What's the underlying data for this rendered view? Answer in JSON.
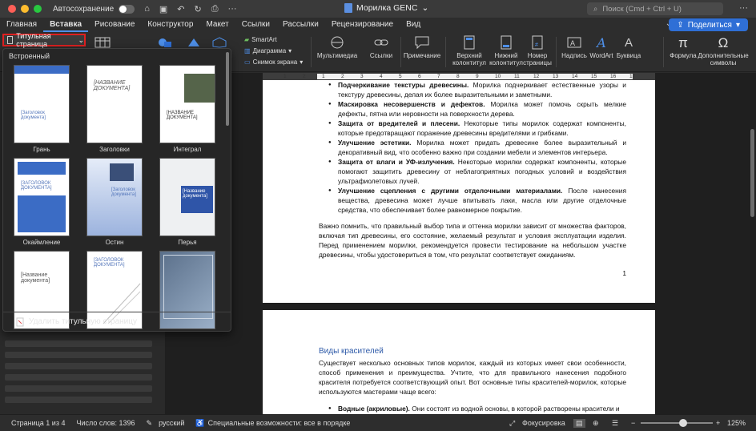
{
  "titlebar": {
    "autosave_label": "Автосохранение",
    "doc_title": "Морилка GENC",
    "search_placeholder": "Поиск (Cmd + Ctrl + U)"
  },
  "tabs": [
    "Главная",
    "Вставка",
    "Рисование",
    "Конструктор",
    "Макет",
    "Ссылки",
    "Рассылки",
    "Рецензирование",
    "Вид"
  ],
  "active_tab": "Вставка",
  "share_label": "Поделиться",
  "ribbon": {
    "title_page_label": "Титульная страница",
    "smartart": "SmartArt",
    "diagram": "Диаграмма",
    "screenshot": "Снимок экрана",
    "multimedia": "Мультимедиа",
    "links": "Ссылки",
    "comment": "Примечание",
    "header": "Верхний колонтитул",
    "footer": "Нижний колонтитул",
    "page_number": "Номер страницы",
    "textbox": "Надпись",
    "wordart": "WordArt",
    "dropcap": "Буквица",
    "formula": "Формула",
    "symbols": "Дополнительные символы"
  },
  "gallery": {
    "section": "Встроенный",
    "items": [
      {
        "name": "Грань",
        "thumb_title": "[Заголовок документа]"
      },
      {
        "name": "Заголовки",
        "thumb_title": "[НАЗВАНИЕ ДОКУМЕНТА]"
      },
      {
        "name": "Интеграл",
        "thumb_title": "[НАЗВАНИЕ ДОКУМЕНТА]"
      },
      {
        "name": "Окаймление",
        "thumb_title": "[ЗАГОЛОВОК ДОКУМЕНТА]"
      },
      {
        "name": "Остин",
        "thumb_title": "[Заголовок документа]"
      },
      {
        "name": "Перья",
        "thumb_title": "[Название документа]"
      },
      {
        "name": "",
        "thumb_title": "[Название документа]"
      },
      {
        "name": "",
        "thumb_title": "[ЗАГОЛОВОК ДОКУМЕНТА]"
      },
      {
        "name": "",
        "thumb_title": ""
      }
    ],
    "remove_label": "Удалить титульную страницу"
  },
  "ruler_ticks": [
    "1",
    "2",
    "1",
    "2",
    "3",
    "4",
    "5",
    "6",
    "7",
    "8",
    "9",
    "10",
    "11",
    "12",
    "13",
    "14",
    "15",
    "16",
    "17"
  ],
  "page1": {
    "bullets": [
      {
        "bold": "Подчеркивание текстуры древесины.",
        "text": " Морилка подчеркивает естественные узоры и текстуру древесины, делая их более выразительными и заметными."
      },
      {
        "bold": "Маскировка несовершенств и дефектов.",
        "text": " Морилка может помочь скрыть мелкие дефекты, пятна или неровности на поверхности дерева."
      },
      {
        "bold": "Защита от вредителей и плесени.",
        "text": " Некоторые типы морилок содержат компоненты, которые предотвращают поражение древесины вредителями и грибками."
      },
      {
        "bold": "Улучшение эстетики.",
        "text": " Морилка может придать древесине более выразительный и декоративный вид, что особенно важно при создании мебели и элементов интерьера."
      },
      {
        "bold": "Защита от влаги и УФ-излучения.",
        "text": " Некоторые морилки содержат компоненты, которые помогают защитить древесину от неблагоприятных погодных условий и воздействия ультрафиолетовых лучей."
      },
      {
        "bold": "Улучшение сцепления с другими отделочными материалами.",
        "text": " После нанесения вещества, древесина может лучше впитывать лаки, масла или другие отделочные средства, что обеспечивает более равномерное покрытие."
      }
    ],
    "paragraph": "Важно помнить, что правильный выбор типа и оттенка морилки зависит от множества факторов, включая тип древесины, его состояние, желаемый результат и условия эксплуатации изделия. Перед применением морилки, рекомендуется провести тестирование на небольшом участке древесины, чтобы удостовериться в том, что результат соответствует ожиданиям.",
    "page_number": "1"
  },
  "page2": {
    "heading": "Виды красителей",
    "paragraph": "Существует несколько основных типов морилок, каждый из которых имеет свои особенности, способ применения и преимущества. Учтите, что для правильного нанесения подобного красителя потребуется соответствующий опыт. Вот основные типы красителей-морилок, которые используются мастерами чаще всего:",
    "bullet_bold": "Водные (акриловые).",
    "bullet_text": " Они состоят из водной основы, в которой растворены красители и"
  },
  "statusbar": {
    "page": "Страница 1 из 4",
    "words": "Число слов: 1396",
    "language": "русский",
    "accessibility": "Специальные возможности: все в порядке",
    "focus": "Фокусировка",
    "zoom": "125%",
    "zoom_level": 0.6
  }
}
